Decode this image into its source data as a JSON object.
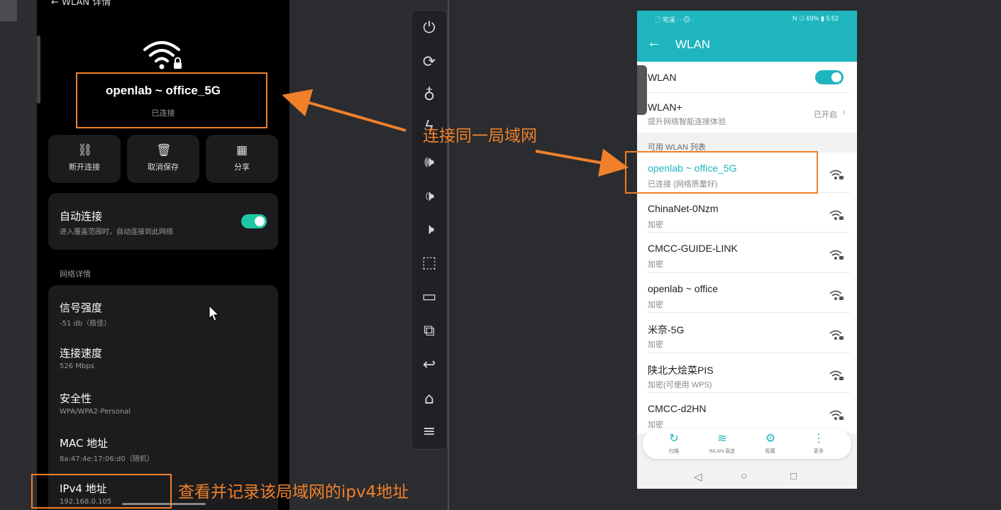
{
  "left_phone": {
    "header_title": "WLAN 详情",
    "ssid": "openlab ~ office_5G",
    "status": "已连接",
    "actions": [
      {
        "label": "断开连接",
        "icon": "unlink-icon"
      },
      {
        "label": "取消保存",
        "icon": "trash-icon"
      },
      {
        "label": "分享",
        "icon": "qr-icon"
      }
    ],
    "auto_connect": {
      "title": "自动连接",
      "subtitle": "进入覆盖范围时，自动连接到此网络",
      "enabled": true
    },
    "section_label": "网络详情",
    "details": [
      {
        "title": "信号强度",
        "value": "-51 db（极佳）"
      },
      {
        "title": "连接速度",
        "value": "526 Mbps"
      },
      {
        "title": "安全性",
        "value": "WPA/WPA2-Personal"
      },
      {
        "title": "MAC 地址",
        "value": "8a:47:4e:17:06:d0（随机）"
      },
      {
        "title": "IPv4 地址",
        "value": "192.168.0.105"
      }
    ]
  },
  "toolbar": {
    "items": [
      "power-icon",
      "rotate-icon",
      "bulb-icon",
      "lightning-icon",
      "volume-up-icon",
      "volume-down-icon",
      "mute-icon",
      "screenshot-icon",
      "record-icon",
      "screen-crop-icon",
      "back-icon",
      "home-icon",
      "menu-icon"
    ]
  },
  "right_phone": {
    "statusbar": {
      "left": "🗋 宅溪 ⋅ ⋅ 🛈 ⋅",
      "right": "N ⚆ 69% ▮ 5:52"
    },
    "title": "WLAN",
    "wlan_toggle": {
      "label": "WLAN",
      "on": true
    },
    "wlan_plus": {
      "title": "WLAN+",
      "subtitle": "提升网络智能连接体验",
      "status": "已开启"
    },
    "section": "可用 WLAN 列表",
    "networks": [
      {
        "name": "openlab ~ office_5G",
        "status": "已连接 (网络质量好)",
        "connected": true
      },
      {
        "name": "ChinaNet-0Nzm",
        "status": "加密",
        "connected": false
      },
      {
        "name": "CMCC-GUIDE-LINK",
        "status": "加密",
        "connected": false
      },
      {
        "name": "openlab ~ office",
        "status": "加密",
        "connected": false
      },
      {
        "name": "米奈-5G",
        "status": "加密",
        "connected": false
      },
      {
        "name": "陕北大烩菜PIS",
        "status": "加密(可使用 WPS)",
        "connected": false
      },
      {
        "name": "CMCC-d2HN",
        "status": "加密",
        "connected": false
      }
    ],
    "bottom_tabs": [
      {
        "label": "扫描",
        "icon": "scan-icon"
      },
      {
        "label": "WLAN 直连",
        "icon": "wifi-direct-icon"
      },
      {
        "label": "配置",
        "icon": "gear-icon"
      },
      {
        "label": "更多",
        "icon": "more-icon"
      }
    ]
  },
  "annotations": {
    "same_lan": "连接同一局域网",
    "record_ipv4": "查看并记录该局域网的ipv4地址"
  },
  "colors": {
    "accent_teal": "#1fb5bf",
    "toggle_green": "#1ec8a5",
    "annotation_orange": "#f0802a"
  }
}
